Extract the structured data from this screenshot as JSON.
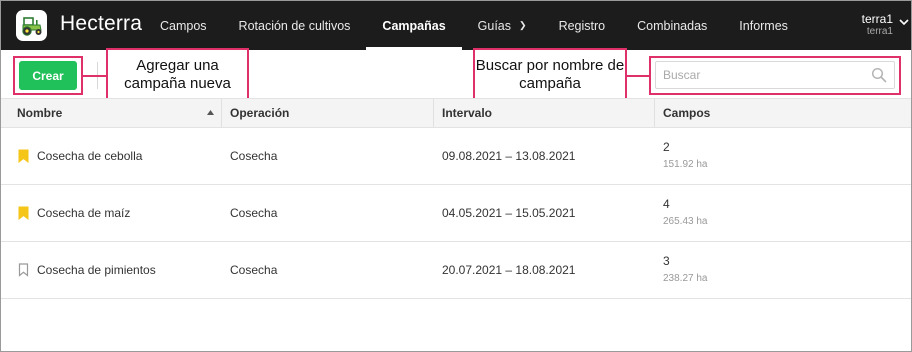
{
  "app": {
    "brand": "Hecterra",
    "logo_icon": "tractor-icon",
    "accent_color": "#20c05a",
    "highlight_color": "#e0306a"
  },
  "nav": {
    "items": [
      {
        "label": "Campos",
        "active": false
      },
      {
        "label": "Rotación de cultivos",
        "active": false
      },
      {
        "label": "Campañas",
        "active": true
      },
      {
        "label": "Guías",
        "active": false,
        "dropdown": true
      },
      {
        "label": "Registro",
        "active": false
      },
      {
        "label": "Combinadas",
        "active": false
      },
      {
        "label": "Informes",
        "active": false
      }
    ],
    "user": {
      "name": "terra1",
      "account": "terra1"
    }
  },
  "toolbar": {
    "create_label": "Crear",
    "search_placeholder": "Buscar",
    "search_value": ""
  },
  "annotations": {
    "create_callout": "Agregar una campaña nueva",
    "search_callout": "Buscar por nombre de campaña"
  },
  "table": {
    "columns": [
      "Nombre",
      "Operación",
      "Intervalo",
      "Campos"
    ],
    "sorted_column": "Nombre",
    "rows": [
      {
        "name": "Cosecha de cebolla",
        "operation": "Cosecha",
        "interval": "09.08.2021 – 13.08.2021",
        "fields": "2",
        "area": "151.92 ha",
        "bookmarked": true
      },
      {
        "name": "Cosecha de maíz",
        "operation": "Cosecha",
        "interval": "04.05.2021 – 15.05.2021",
        "fields": "4",
        "area": "265.43 ha",
        "bookmarked": true
      },
      {
        "name": "Cosecha de pimientos",
        "operation": "Cosecha",
        "interval": "20.07.2021 – 18.08.2021",
        "fields": "3",
        "area": "238.27 ha",
        "bookmarked": false
      }
    ]
  }
}
